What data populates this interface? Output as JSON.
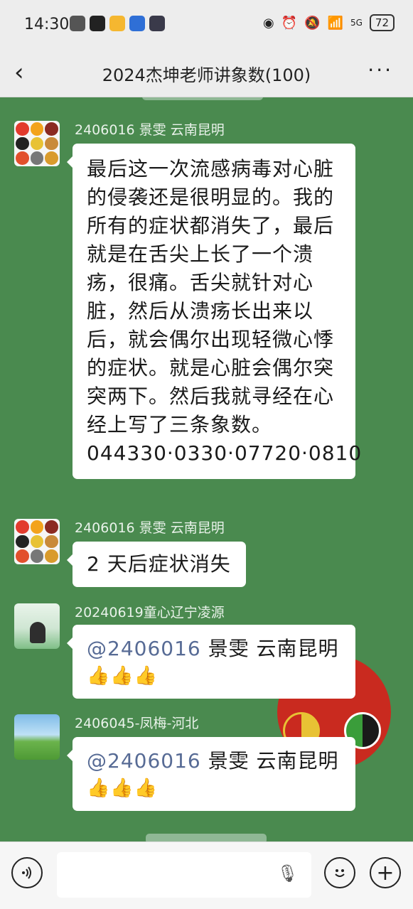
{
  "status_bar": {
    "time": "14:30",
    "battery": "72",
    "network": "5G"
  },
  "header": {
    "back_icon": "chevron-left-icon",
    "title": "2024杰坤老师讲象数(100)",
    "more_icon": "more-dots-icon"
  },
  "messages": [
    {
      "sender": "2406016  景雯  云南昆明",
      "text": "最后这一次流感病毒对心脏的侵袭还是很明显的。我的所有的症状都消失了，最后就是在舌尖上长了一个溃疡，很痛。舌尖就针对心脏，然后从溃疡长出来以后，就会偶尔出现轻微心悸的症状。就是心脏会偶尔突突两下。然后我就寻经在心经上写了三条象数。044330·0330·07720·0810"
    },
    {
      "sender": "2406016  景雯  云南昆明",
      "text": "2 天后症状消失"
    },
    {
      "sender": "20240619童心辽宁凌源",
      "mention": "@2406016",
      "text": "  景雯  云南昆明",
      "emoji": "👍👍👍"
    },
    {
      "sender": "2406045-凤梅-河北",
      "mention": "@2406016",
      "text": "  景雯  云南昆明",
      "emoji": "👍👍👍"
    }
  ],
  "input_bar": {
    "voice_icon": "voice-icon",
    "mic_icon": "mic-icon",
    "emoji_icon": "emoji-icon",
    "add_icon": "plus-icon"
  },
  "colors": {
    "chat_background": "#4a8a4f",
    "mention": "#576b95",
    "bar_background": "#ededed"
  }
}
